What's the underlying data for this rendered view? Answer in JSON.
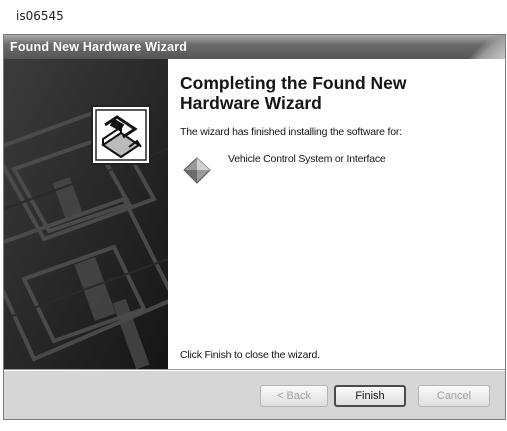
{
  "figure_id": "is06545",
  "window": {
    "title": "Found New Hardware Wizard"
  },
  "content": {
    "heading": "Completing the Found New Hardware Wizard",
    "intro": "The wizard has finished installing the software for:",
    "device_name": "Vehicle Control System or Interface",
    "finish_note": "Click Finish to close the wizard."
  },
  "buttons": {
    "back": "< Back",
    "finish": "Finish",
    "cancel": "Cancel"
  },
  "colors": {
    "side_panel": "#1e1e1e",
    "dialog_bg": "#d6d6d6"
  },
  "icons": {
    "wizard": "hardware-install-icon",
    "device": "device-diamond-icon"
  }
}
